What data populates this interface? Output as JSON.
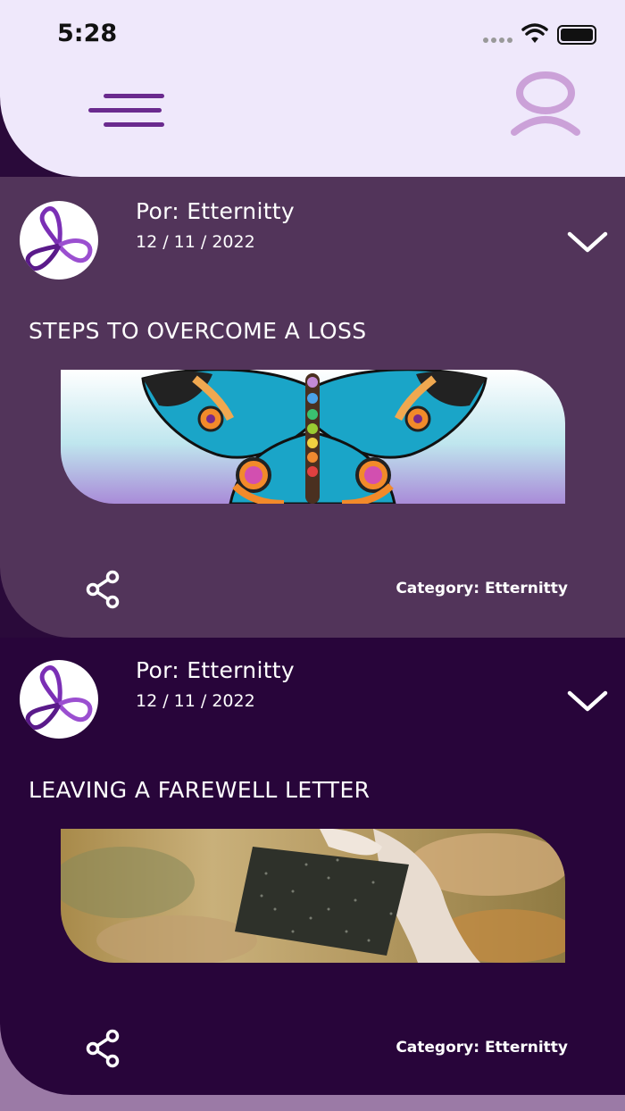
{
  "status_bar": {
    "time": "5:28"
  },
  "header": {
    "menu_icon": "hamburger-menu-icon",
    "profile_icon": "user-profile-icon"
  },
  "posts": [
    {
      "author": "Por: Etternitty",
      "date": "12 / 11 / 2022",
      "title": "STEPS TO OVERCOME A LOSS",
      "image": "butterfly-illustration",
      "category": "Category: Etternitty"
    },
    {
      "author": "Por: Etternitty",
      "date": "12 / 11 / 2022",
      "title": "LEAVING A FAREWELL LETTER",
      "image": "hand-holding-paper-photo",
      "category": "Category: Etternitty"
    }
  ],
  "colors": {
    "header_bg": "#efe8fb",
    "card1_bg": "#52345a",
    "card2_bg": "#28053a",
    "accent": "#6a2a8e"
  }
}
